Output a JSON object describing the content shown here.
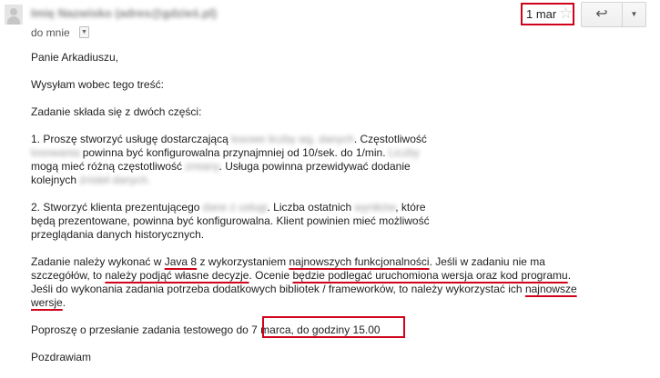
{
  "header": {
    "sender_blurred": "Imię Nazwisko (adres@gdzieś.pl)",
    "recipient": "do mnie",
    "date": "1 mar",
    "star_icon": "star-outline-icon",
    "reply_icon": "reply-arrow-icon",
    "more_icon": "triangle-down-icon",
    "highlight_color": "#d0021b"
  },
  "body": {
    "greeting": "Panie Arkadiuszu,",
    "intro": "Wysyłam wobec tego treść:",
    "task_intro": "Zadanie składa się z dwóch części:",
    "p1": {
      "a": "1. Proszę stworzyć usługę dostarczającą ",
      "b_blur": "losowe liczby wg. danych",
      "c": ". Częstotliwość",
      "d_blur": "losowania",
      "e": " powinna być konfigurowalna przynajmniej od 10/sek. do 1/min.",
      "f_blur": "Liczby",
      "g": "mogą mieć różną częstotliwość ",
      "h_blur": "zmiany",
      "i": ". Usługa powinna przewidywać dodanie",
      "j": "kolejnych ",
      "k_blur": "źródeł danych."
    },
    "p2": {
      "a": "2. Stworzyć klienta prezentującego ",
      "b_blur": "dane z usługi",
      "c": ". Liczba ostatnich ",
      "d_blur": "wyników",
      "e": ", które",
      "f": "będą prezentowane, powinna być konfigurowalna. Klient powinien mieć możliwość",
      "g": "przeglądania danych historycznych."
    },
    "p3": {
      "a": "Zadanie należy wykonać w ",
      "b": "Java 8",
      "c": " z wykorzystaniem ",
      "d": "najnowszych funkcjonalności",
      "e": ". Jeśli w zadaniu nie ma",
      "f": "szczegółów, to ",
      "g": "należy podjąć własne decyzje",
      "h": ". Ocenie ",
      "i": "będzie podlegać uruchomiona wersja oraz kod programu",
      "j": ".",
      "k": "Jeśli do wykonania zadania potrzeba dodatkowych bibliotek / frameworków, to należy wykorzystać ich ",
      "l": "najnowsze",
      "m": "wersje",
      "n": "."
    },
    "p4": {
      "a": "Poproszę o przesłanie zadania testowego do ",
      "b": "7 marca, do godziny 15.00"
    },
    "closing": "Pozdrawiam"
  }
}
